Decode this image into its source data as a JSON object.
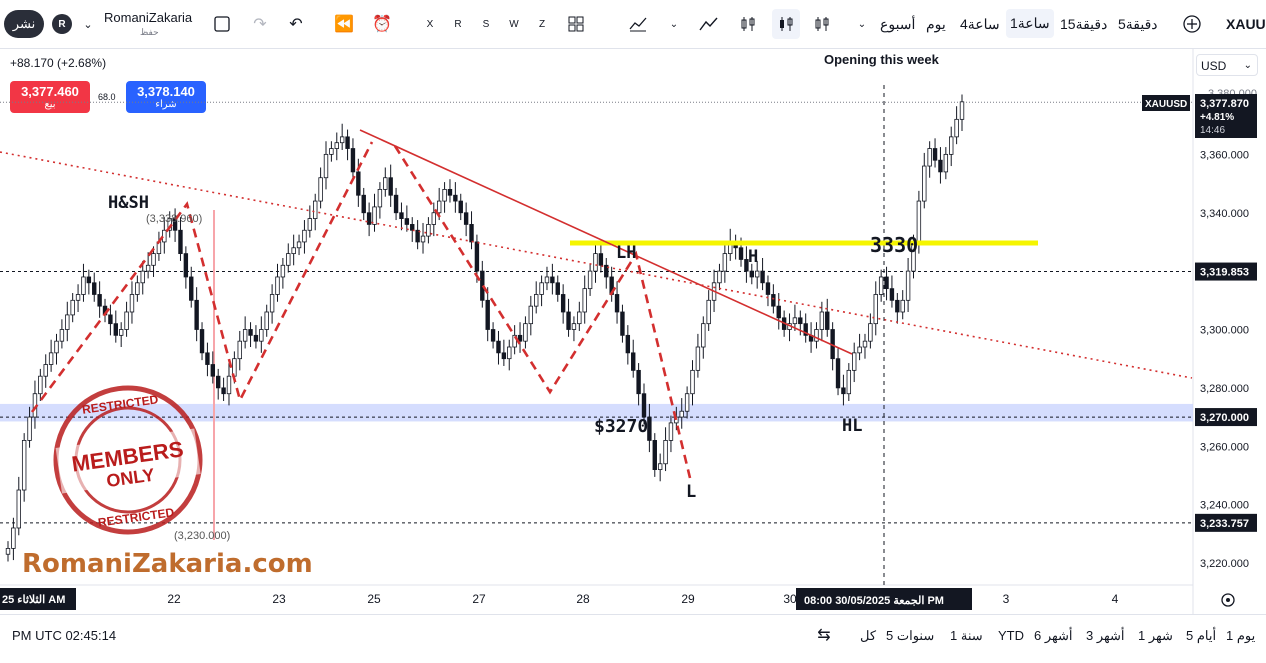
{
  "toolbar": {
    "publish_label": "نشر",
    "avatar_letter": "R",
    "username": "RomaniZakaria",
    "username_sub": "حفظ",
    "symbol": "XAUUS",
    "indicator_letters": [
      "X",
      "R",
      "S",
      "W",
      "Z"
    ],
    "timeframes": [
      "5دقيقة",
      "15دقيقة",
      "1ساعة",
      "4ساعة",
      "يوم",
      "أسبوع"
    ],
    "selected_timeframe": "1ساعة"
  },
  "legend": {
    "change": "+88.170 (+2.68%)",
    "sell_price": "3,377.460",
    "sell_label": "بيع",
    "spread": "68.0",
    "buy_price": "3,378.140",
    "buy_label": "شراء"
  },
  "currency": "USD",
  "colors": {
    "up_candle": "#131722",
    "accent_red": "#f23645",
    "accent_blue": "#2962ff",
    "trend_red": "#d32f2f",
    "support_band": "#c7d2fe",
    "yellow_level": "#f5f500"
  },
  "chart_data": {
    "type": "candlestick",
    "symbol": "XAUUSD",
    "ylim": [
      3210,
      3290
    ],
    "y_ticks": [
      "3,220.000",
      "3,240.000",
      "3,260.000",
      "3,280.000",
      "3,300.000",
      "3,320.000",
      "3,340.000",
      "3,360.000",
      "3,380.000"
    ],
    "y_tick_values": [
      3220,
      3240,
      3260,
      3280,
      3300,
      3320,
      3340,
      3360,
      3380
    ],
    "x_ticks": [
      "22",
      "23",
      "25",
      "27",
      "28",
      "29",
      "30",
      "3",
      "4"
    ],
    "x_first_label": "25 الثلاثاء AM",
    "crosshair_label": "08:00   30/05/2025 الجمعة PM",
    "price_label": {
      "symbol": "XAUUSD",
      "price": "3,377.870",
      "change": "+4.81%",
      "countdown": "14:46"
    },
    "level_labels": [
      "3,319.853",
      "3,270.000",
      "3,233.757"
    ],
    "annotations": {
      "opening": "Opening this week",
      "hs": "H&SH",
      "hs_value": "(3,338.960)",
      "low_value": "(3,230.000)",
      "lh": "LH",
      "h": "H",
      "level_3330": "3330",
      "l": "L",
      "hl": "HL",
      "support": "$3270"
    },
    "watermark": {
      "stamp_top": "RESTRICTED",
      "stamp_mid1": "MEMBERS",
      "stamp_mid2": "ONLY",
      "stamp_bottom": "RESTRICTED",
      "site": "RomaniZakaria.com"
    },
    "candles": [
      3225,
      3232,
      3245,
      3262,
      3270,
      3278,
      3284,
      3288,
      3292,
      3296,
      3300,
      3305,
      3310,
      3312,
      3318,
      3316,
      3312,
      3308,
      3305,
      3302,
      3298,
      3300,
      3306,
      3312,
      3316,
      3320,
      3322,
      3326,
      3330,
      3334,
      3338,
      3334,
      3326,
      3318,
      3310,
      3300,
      3292,
      3288,
      3284,
      3280,
      3278,
      3284,
      3290,
      3296,
      3300,
      3298,
      3296,
      3300,
      3306,
      3312,
      3318,
      3322,
      3326,
      3328,
      3330,
      3334,
      3338,
      3344,
      3352,
      3360,
      3362,
      3364,
      3366,
      3362,
      3354,
      3346,
      3340,
      3336,
      3342,
      3348,
      3352,
      3346,
      3340,
      3338,
      3336,
      3334,
      3330,
      3332,
      3336,
      3340,
      3344,
      3348,
      3346,
      3344,
      3340,
      3336,
      3330,
      3320,
      3310,
      3300,
      3296,
      3292,
      3290,
      3294,
      3298,
      3296,
      3302,
      3308,
      3312,
      3316,
      3318,
      3316,
      3312,
      3306,
      3300,
      3302,
      3306,
      3314,
      3320,
      3326,
      3322,
      3318,
      3312,
      3306,
      3298,
      3292,
      3286,
      3278,
      3270,
      3262,
      3252,
      3254,
      3262,
      3268,
      3270,
      3272,
      3278,
      3286,
      3294,
      3302,
      3310,
      3316,
      3320,
      3326,
      3330,
      3328,
      3324,
      3320,
      3318,
      3320,
      3316,
      3312,
      3308,
      3304,
      3300,
      3302,
      3304,
      3302,
      3298,
      3296,
      3300,
      3306,
      3300,
      3290,
      3280,
      3278,
      3286,
      3292,
      3294,
      3296,
      3302,
      3312,
      3318,
      3314,
      3310,
      3306,
      3310,
      3320,
      3330,
      3344,
      3356,
      3362,
      3358,
      3354,
      3360,
      3366,
      3372,
      3378
    ]
  },
  "bottombar": {
    "time": "PM UTC 02:45:14",
    "ranges": [
      "كل",
      "5 سنوات",
      "1 سنة",
      "YTD",
      "6 أشهر",
      "3 أشهر",
      "1 شهر",
      "5 أيام",
      "1 يوم"
    ]
  }
}
